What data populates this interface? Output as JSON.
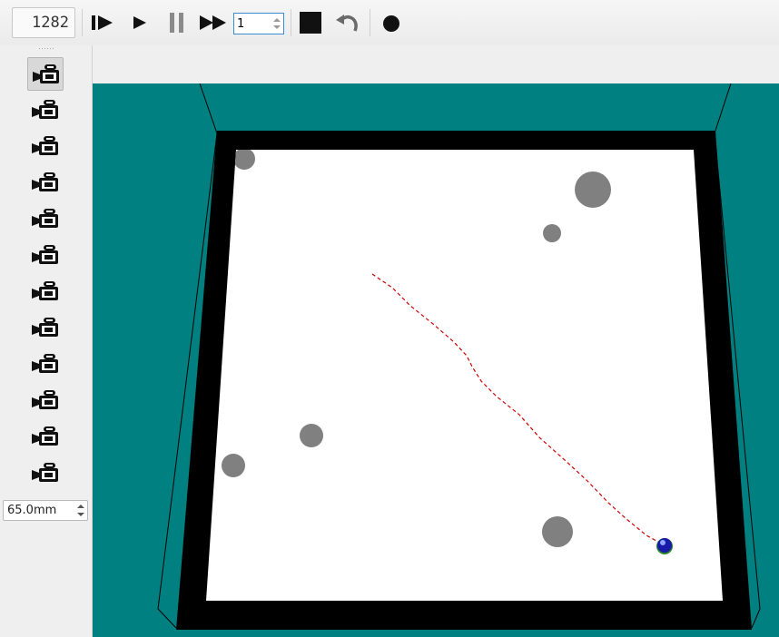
{
  "toolbar": {
    "step_counter": "1282",
    "speed_value": "1",
    "buttons": [
      {
        "name": "step-button",
        "icon": "step-forward-icon"
      },
      {
        "name": "play-button",
        "icon": "play-icon"
      },
      {
        "name": "pause-button",
        "icon": "pause-icon"
      },
      {
        "name": "fast-forward-button",
        "icon": "fast-forward-icon"
      },
      {
        "name": "stop-button",
        "icon": "stop-icon"
      },
      {
        "name": "reset-button",
        "icon": "undo-icon"
      },
      {
        "name": "record-button",
        "icon": "record-icon"
      }
    ]
  },
  "camera_panel": {
    "camera_count": 12,
    "selected_index": 0,
    "icon": "video-camera-icon",
    "zoom_value": "65.0mm"
  },
  "scene": {
    "background_color": "#008080",
    "wall_color": "#000000",
    "floor_color": "#ffffff",
    "obstacle_color": "#808080",
    "robot_color": "#1a1aa8",
    "trail_color": "#cc0000"
  }
}
